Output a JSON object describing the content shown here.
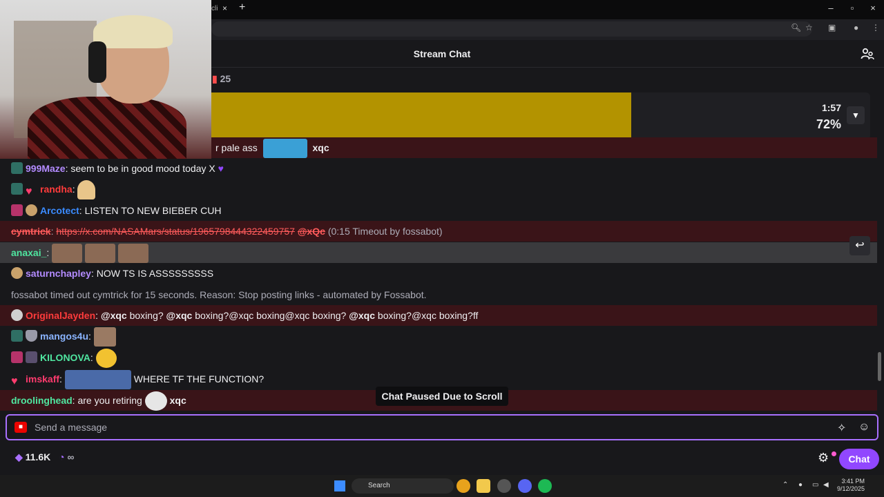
{
  "browser": {
    "tab_close": "×",
    "tab_new": "+",
    "window_controls": [
      "–",
      "▫",
      "×"
    ]
  },
  "header": {
    "title": "Stream Chat"
  },
  "gift_count": "25",
  "poll": {
    "time": "1:57",
    "percent_label": "72%",
    "percent": 0.72
  },
  "messages": [
    {
      "id": "m0",
      "text": "r pale ass",
      "trail": "xqc"
    },
    {
      "id": "m1",
      "user": "999Maze",
      "user_color": "#b38bff",
      "text": "seem to be in good mood today X"
    },
    {
      "id": "m2",
      "user": "randha",
      "user_color": "#ff3b3b"
    },
    {
      "id": "m3",
      "user": "Arcotect",
      "user_color": "#3a8bff",
      "text": "LISTEN TO NEW BIEBER CUH"
    },
    {
      "id": "m4",
      "user": "cymtrick",
      "user_color": "#ff3b3b",
      "link": "https://x.com/NASAMars/status/1965798444322459757",
      "mention": "@xQc",
      "note": "(0:15 Timeout by fossabot)"
    },
    {
      "id": "m5",
      "user": "anaxai_",
      "user_color": "#4fe6a0"
    },
    {
      "id": "m6",
      "user": "saturnchapley",
      "user_color": "#b38bff",
      "text": "NOW TS IS ASSSSSSSSS"
    },
    {
      "id": "m7",
      "system": "fossabot timed out cymtrick for 15 seconds. Reason: Stop posting links - automated by Fossabot."
    },
    {
      "id": "m8",
      "user": "OriginalJayden",
      "user_color": "#ff3b3b",
      "parts": [
        "@xqc",
        " boxing? ",
        "@xqc",
        " boxing?@xqc boxing@xqc boxing? ",
        "@xqc",
        " boxing?@xqc boxing?ff"
      ]
    },
    {
      "id": "m9",
      "user": "mangos4u",
      "user_color": "#8ab4ff"
    },
    {
      "id": "m10",
      "user": "KILONOVA",
      "user_color": "#4fe6a0"
    },
    {
      "id": "m11",
      "user": "imskaff",
      "user_color": "#ff3b6e",
      "text": "WHERE TF THE FUNCTION?"
    },
    {
      "id": "m12",
      "user": "droolinghead",
      "user_color": "#4fe6a0",
      "text": "are you retiring",
      "trail": "xqc"
    }
  ],
  "paused_label": "Chat Paused Due to Scroll",
  "input": {
    "placeholder": "Send a message"
  },
  "footer": {
    "points": "11.6K",
    "infinity": "∞",
    "chat_button": "Chat"
  },
  "taskbar": {
    "search": "Search",
    "time": "3:41 PM",
    "date": "9/12/2025"
  },
  "colors": {
    "accent": "#9147ff",
    "poll_fill": "#b39300",
    "highlight_row": "#3a1418"
  },
  "icons": [
    "users-icon",
    "chevron-down-icon",
    "reply-icon",
    "camera-icon",
    "sparkle-icon",
    "emoji-icon",
    "gear-icon",
    "channel-points-icon",
    "clock-icon"
  ]
}
